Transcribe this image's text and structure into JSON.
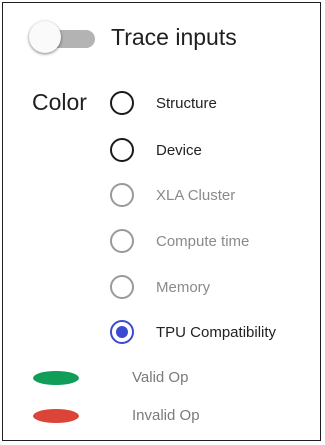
{
  "trace": {
    "label": "Trace inputs",
    "enabled": false
  },
  "color": {
    "label": "Color",
    "options": [
      {
        "label": "Structure",
        "selected": false,
        "enabled": true
      },
      {
        "label": "Device",
        "selected": false,
        "enabled": true
      },
      {
        "label": "XLA Cluster",
        "selected": false,
        "enabled": false
      },
      {
        "label": "Compute time",
        "selected": false,
        "enabled": false
      },
      {
        "label": "Memory",
        "selected": false,
        "enabled": false
      },
      {
        "label": "TPU Compatibility",
        "selected": true,
        "enabled": true
      }
    ]
  },
  "legend": {
    "items": [
      {
        "label": "Valid Op",
        "color": "#0f9d58"
      },
      {
        "label": "Invalid Op",
        "color": "#db4437"
      }
    ]
  },
  "colors": {
    "accent": "#3a4ad1",
    "toggle_track": "#b3b3b3"
  }
}
